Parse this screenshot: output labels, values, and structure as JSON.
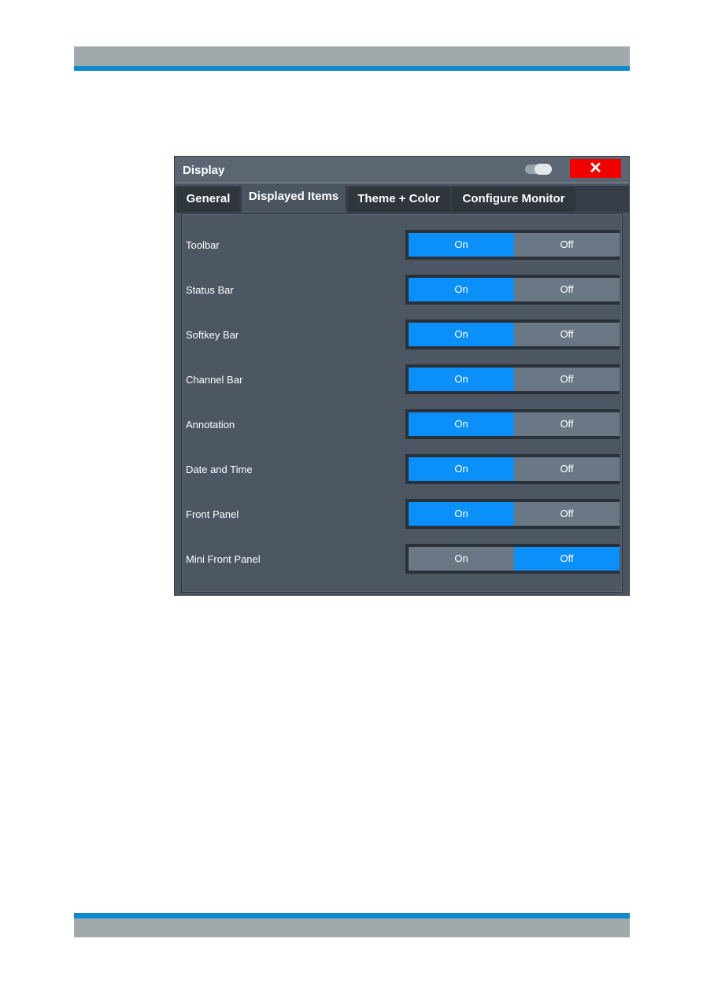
{
  "dialog": {
    "title": "Display",
    "close_label": "✕",
    "tabs": [
      {
        "label": "General",
        "active": false
      },
      {
        "label": "Displayed Items",
        "active": true
      },
      {
        "label": "Theme + Color",
        "active": false
      },
      {
        "label": "Configure Monitor",
        "active": false
      }
    ],
    "items": [
      {
        "label": "Toolbar",
        "on": "On",
        "off": "Off",
        "state": "on"
      },
      {
        "label": "Status Bar",
        "on": "On",
        "off": "Off",
        "state": "on"
      },
      {
        "label": "Softkey Bar",
        "on": "On",
        "off": "Off",
        "state": "on"
      },
      {
        "label": "Channel Bar",
        "on": "On",
        "off": "Off",
        "state": "on"
      },
      {
        "label": "Annotation",
        "on": "On",
        "off": "Off",
        "state": "on"
      },
      {
        "label": "Date and Time",
        "on": "On",
        "off": "Off",
        "state": "on"
      },
      {
        "label": "Front Panel",
        "on": "On",
        "off": "Off",
        "state": "on"
      },
      {
        "label": "Mini Front Panel",
        "on": "On",
        "off": "Off",
        "state": "off"
      }
    ]
  },
  "colors": {
    "accent": "#0b8ff8",
    "close": "#f20000",
    "header_bar": "#a2a9ad",
    "header_line": "#0e8acb"
  }
}
